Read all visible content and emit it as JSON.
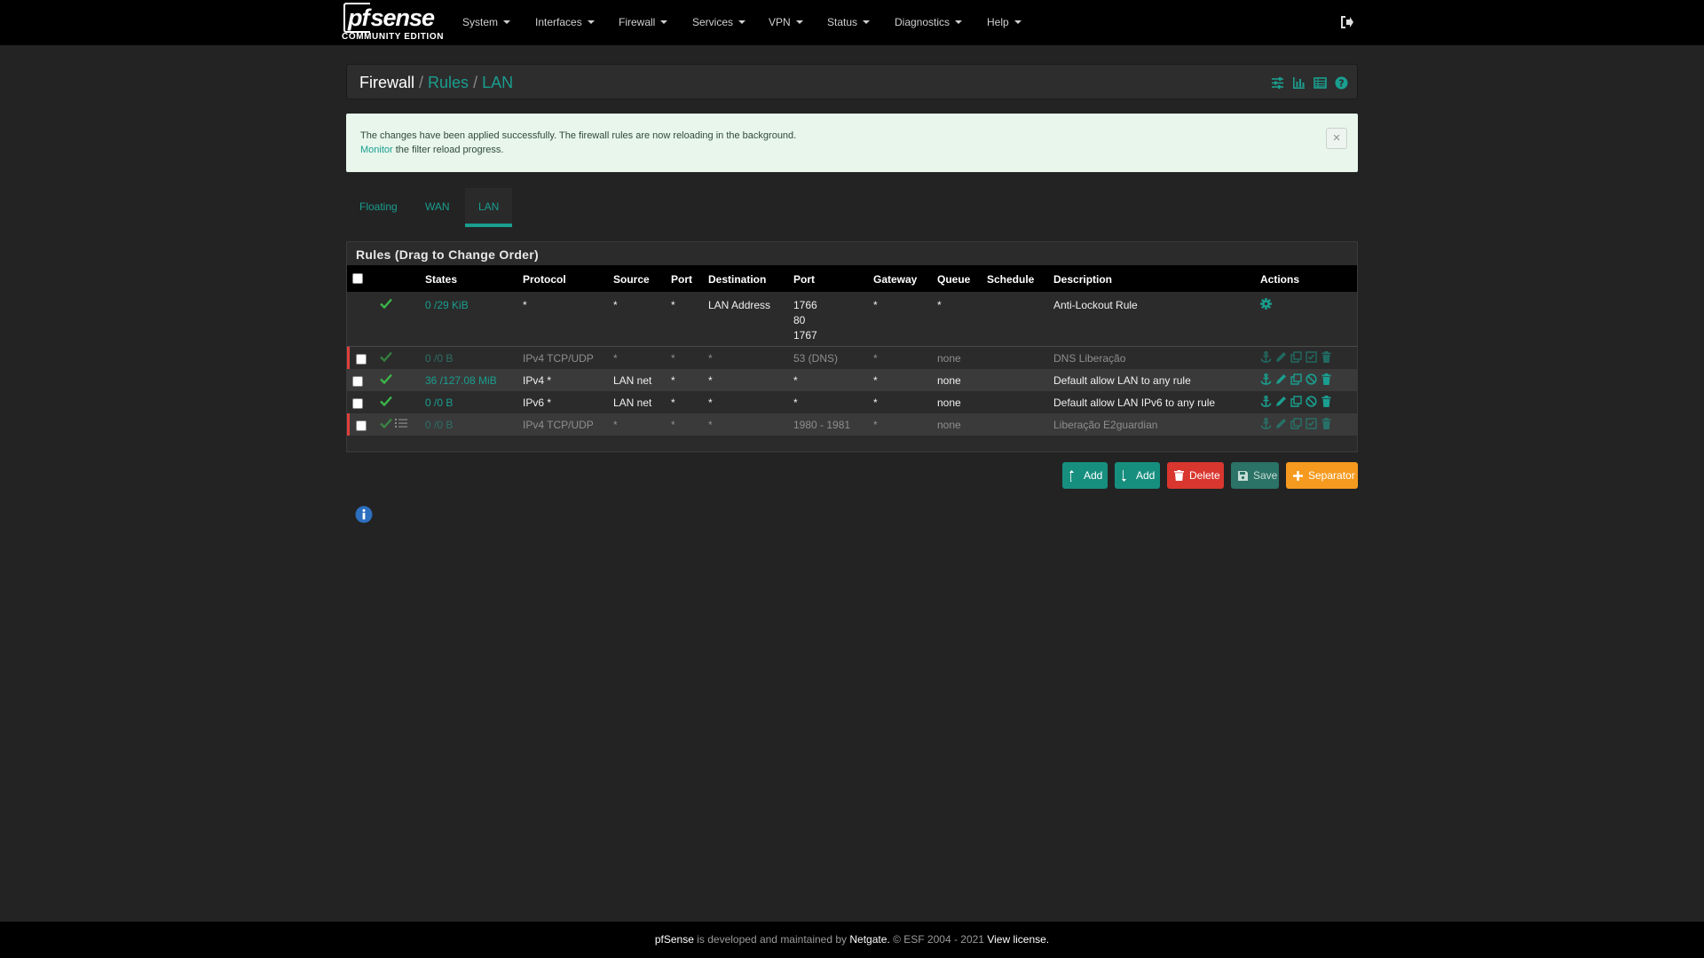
{
  "brand": {
    "logo_text": "pfsense",
    "edition": "COMMUNITY EDITION"
  },
  "nav": {
    "items": [
      "System",
      "Interfaces",
      "Firewall",
      "Services",
      "VPN",
      "Status",
      "Diagnostics",
      "Help"
    ],
    "logout_icon": "sign-out-icon"
  },
  "breadcrumb": {
    "part1": "Firewall",
    "part2": "Rules",
    "part3": "LAN"
  },
  "breadcrumb_icons": [
    "sliders-icon",
    "bar-chart-icon",
    "table-icon",
    "question-circle-icon"
  ],
  "alert": {
    "line1": "The changes have been applied successfully. The firewall rules are now reloading in the background.",
    "link": "Monitor",
    "line2_rest": " the filter reload progress.",
    "close": "×"
  },
  "tabs": [
    "Floating",
    "WAN",
    "LAN"
  ],
  "active_tab": "LAN",
  "rules": {
    "title": "Rules (Drag to Change Order)",
    "headers": [
      "States",
      "Protocol",
      "Source",
      "Port",
      "Destination",
      "Port",
      "Gateway",
      "Queue",
      "Schedule",
      "Description",
      "Actions"
    ],
    "rows": [
      {
        "states": "0 /29 KiB",
        "protocol": "*",
        "source": "*",
        "source_port": "*",
        "destination": "LAN Address",
        "dest_port": [
          "1766",
          "80",
          "1767"
        ],
        "gateway": "*",
        "queue": "*",
        "schedule": "",
        "description": "Anti-Lockout Rule",
        "disabled": false
      },
      {
        "states": "0 /0 B",
        "protocol": "IPv4 TCP/UDP",
        "source": "*",
        "source_port": "*",
        "destination": "*",
        "dest_port": "53 (DNS)",
        "gateway": "*",
        "queue": "none",
        "schedule": "",
        "description": "DNS Liberação",
        "disabled": true
      },
      {
        "states": "36 /127.08 MiB",
        "protocol": "IPv4 *",
        "source": "LAN net",
        "source_port": "*",
        "destination": "*",
        "dest_port": "*",
        "gateway": "*",
        "queue": "none",
        "schedule": "",
        "description": "Default allow LAN to any rule",
        "disabled": false
      },
      {
        "states": "0 /0 B",
        "protocol": "IPv6 *",
        "source": "LAN net",
        "source_port": "*",
        "destination": "*",
        "dest_port": "*",
        "gateway": "*",
        "queue": "none",
        "schedule": "",
        "description": "Default allow LAN IPv6 to any rule",
        "disabled": false
      },
      {
        "states": "0 /0 B",
        "protocol": "IPv4 TCP/UDP",
        "source": "*",
        "source_port": "*",
        "destination": "*",
        "dest_port": "1980 - 1981",
        "gateway": "*",
        "queue": "none",
        "schedule": "",
        "description": "Liberação E2guardian",
        "disabled": true
      }
    ]
  },
  "buttons": {
    "add_top": "Add",
    "add_bottom": "Add",
    "delete": "Delete",
    "save": "Save",
    "separator": "Separator"
  },
  "footer": {
    "brand": "pfSense",
    "text1": " is developed and maintained by ",
    "company": "Netgate.",
    "text2": " © ESF 2004 - 2021 ",
    "license": "View license."
  },
  "colors": {
    "accent": "#1a9e8f",
    "navbar": "#000000",
    "background": "#232323",
    "danger": "#d9362f",
    "warning": "#f59a1e",
    "success_alert": "#e8f6ec"
  }
}
